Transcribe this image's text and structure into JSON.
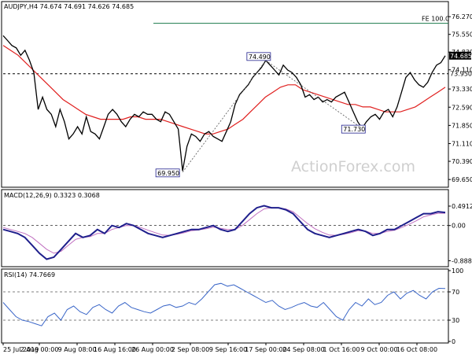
{
  "title": "AUDJPY,H4  74.674 74.691 74.626 74.685",
  "watermark": "ActionForex.com",
  "colors": {
    "price": "#000000",
    "ema": "#e0201f",
    "macd": "#1f1f8c",
    "signal": "#c070c0",
    "level": "#000000",
    "fe": "#1a7a4a"
  },
  "chart_data": [
    {
      "type": "line",
      "name": "price",
      "title": "AUDJPY,H4  74.674 74.691 74.626 74.685",
      "y_ticks": [
        "76.270",
        "75.550",
        "74.830",
        "74.110",
        "73.330",
        "72.590",
        "71.850",
        "71.110",
        "70.390",
        "69.650"
      ],
      "ylim": [
        69.4,
        76.5
      ],
      "x_ticks": [
        "25 Jul 2019",
        "2 Aug 00:00",
        "9 Aug 08:00",
        "16 Aug 16:00",
        "26 Aug 00:00",
        "2 Sep 08:00",
        "9 Sep 16:00",
        "17 Sep 00:00",
        "24 Sep 08:00",
        "1 Oct 16:00",
        "9 Oct 00:00",
        "16 Oct 08:00"
      ],
      "series": [
        {
          "values": [
            75.5,
            75.3,
            75.1,
            75.0,
            74.7,
            74.9,
            74.5,
            74.0,
            72.5,
            73.0,
            72.5,
            72.3,
            71.8,
            72.5,
            72.0,
            71.3,
            71.5,
            71.8,
            71.5,
            72.2,
            71.6,
            71.5,
            71.3,
            71.8,
            72.3,
            72.5,
            72.3,
            72.0,
            71.8,
            72.1,
            72.3,
            72.2,
            72.4,
            72.3,
            72.3,
            72.1,
            72.0,
            72.4,
            72.3,
            72.0,
            71.7,
            70.0,
            71.0,
            71.5,
            71.4,
            71.2,
            71.5,
            71.6,
            71.4,
            71.3,
            71.2,
            71.6,
            72.0,
            72.7,
            73.1,
            73.3,
            73.5,
            73.8,
            74.0,
            74.2,
            74.49,
            74.3,
            74.1,
            73.9,
            74.3,
            74.1,
            74.0,
            73.8,
            73.5,
            73.0,
            73.1,
            72.9,
            73.0,
            72.8,
            72.9,
            72.8,
            73.0,
            73.1,
            73.2,
            72.8,
            72.4,
            72.0,
            71.73,
            72.0,
            72.2,
            72.3,
            72.1,
            72.4,
            72.5,
            72.2,
            72.6,
            73.2,
            73.8,
            74.0,
            73.7,
            73.5,
            73.4,
            73.6,
            74.0,
            74.3,
            74.4,
            74.685
          ]
        },
        {
          "values": [
            75.1,
            74.9,
            74.7,
            74.4,
            74.1,
            73.8,
            73.5,
            73.2,
            72.9,
            72.7,
            72.5,
            72.3,
            72.2,
            72.1,
            72.1,
            72.1,
            72.1,
            72.2,
            72.2,
            72.1,
            72.1,
            72.1,
            72.0,
            71.9,
            71.8,
            71.7,
            71.6,
            71.5,
            71.5,
            71.6,
            71.7,
            71.9,
            72.1,
            72.4,
            72.7,
            73.0,
            73.2,
            73.4,
            73.5,
            73.5,
            73.3,
            73.2,
            73.1,
            73.0,
            72.9,
            72.8,
            72.7,
            72.7,
            72.6,
            72.6,
            72.5,
            72.4,
            72.4,
            72.4,
            72.5,
            72.6,
            72.8,
            73.0,
            73.2,
            73.4
          ]
        }
      ],
      "annotations": [
        {
          "label": "74.490",
          "x_index": 60,
          "y": 74.49
        },
        {
          "label": "69.950",
          "x_index": 41,
          "y": 69.95
        },
        {
          "label": "71.730",
          "x_index": 82,
          "y": 71.73
        }
      ],
      "levels": [
        {
          "value": 73.95,
          "label": "73.950"
        },
        {
          "value": 76.0,
          "label": "FE 100.0"
        }
      ],
      "last_price_label": "74.685"
    },
    {
      "type": "line",
      "name": "macd",
      "title": "MACD(12,26,9) 0.3323 0.3068",
      "y_ticks": [
        "0.4912",
        "0.00",
        "-0.8889"
      ],
      "ylim": [
        -1.0,
        0.65
      ],
      "series": [
        {
          "values": [
            -0.1,
            -0.15,
            -0.2,
            -0.3,
            -0.5,
            -0.7,
            -0.85,
            -0.8,
            -0.6,
            -0.4,
            -0.2,
            -0.3,
            -0.25,
            -0.1,
            -0.2,
            0.0,
            -0.05,
            0.05,
            0.0,
            -0.1,
            -0.2,
            -0.25,
            -0.3,
            -0.25,
            -0.2,
            -0.15,
            -0.1,
            -0.1,
            -0.05,
            0.0,
            -0.1,
            -0.15,
            -0.1,
            0.1,
            0.3,
            0.45,
            0.5,
            0.45,
            0.45,
            0.4,
            0.3,
            0.1,
            -0.1,
            -0.2,
            -0.25,
            -0.3,
            -0.25,
            -0.2,
            -0.15,
            -0.1,
            -0.15,
            -0.25,
            -0.2,
            -0.1,
            -0.1,
            0.0,
            0.1,
            0.2,
            0.3,
            0.3,
            0.35,
            0.33
          ]
        },
        {
          "values": [
            -0.05,
            -0.1,
            -0.15,
            -0.2,
            -0.3,
            -0.45,
            -0.6,
            -0.7,
            -0.65,
            -0.5,
            -0.35,
            -0.3,
            -0.28,
            -0.2,
            -0.2,
            -0.1,
            -0.05,
            0.0,
            0.0,
            -0.05,
            -0.12,
            -0.18,
            -0.24,
            -0.25,
            -0.22,
            -0.18,
            -0.13,
            -0.11,
            -0.08,
            -0.04,
            -0.07,
            -0.1,
            -0.1,
            0.0,
            0.15,
            0.3,
            0.42,
            0.45,
            0.45,
            0.42,
            0.35,
            0.2,
            0.05,
            -0.08,
            -0.17,
            -0.24,
            -0.25,
            -0.22,
            -0.18,
            -0.13,
            -0.14,
            -0.2,
            -0.2,
            -0.15,
            -0.12,
            -0.05,
            0.03,
            0.12,
            0.22,
            0.27,
            0.31,
            0.31
          ]
        }
      ]
    },
    {
      "type": "line",
      "name": "rsi",
      "title": "RSI(14) 74.7669",
      "y_ticks": [
        "100",
        "70",
        "30",
        "0"
      ],
      "ylim": [
        0,
        100
      ],
      "series": [
        {
          "values": [
            55,
            45,
            35,
            30,
            28,
            25,
            22,
            35,
            40,
            30,
            45,
            50,
            42,
            38,
            48,
            52,
            45,
            40,
            50,
            55,
            48,
            45,
            42,
            40,
            45,
            50,
            52,
            48,
            50,
            55,
            52,
            60,
            70,
            80,
            82,
            78,
            80,
            75,
            70,
            65,
            60,
            55,
            58,
            50,
            45,
            48,
            52,
            55,
            50,
            48,
            55,
            45,
            35,
            30,
            45,
            55,
            50,
            60,
            52,
            55,
            65,
            70,
            60,
            68,
            72,
            65,
            60,
            70,
            75,
            74.77
          ]
        }
      ]
    }
  ]
}
